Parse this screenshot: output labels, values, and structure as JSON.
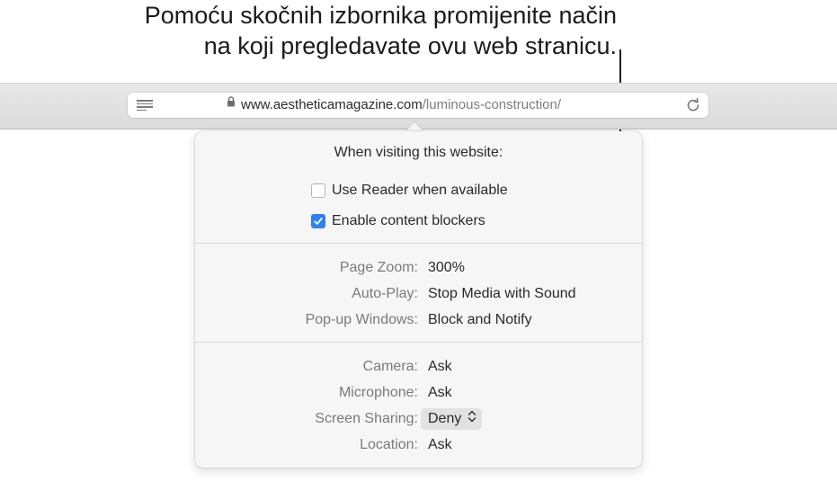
{
  "callout": {
    "line1": "Pomoću skočnih izbornika promijenite način",
    "line2": "na koji pregledavate ovu web stranicu."
  },
  "toolbar": {
    "url_domain": "www.aestheticamagazine.com",
    "url_path": "/luminous-construction/",
    "icons": [
      "reader-icon",
      "lock-icon",
      "reload-icon"
    ]
  },
  "popover": {
    "title": "When visiting this website:",
    "checkboxes": [
      {
        "label": "Use Reader when available",
        "checked": false
      },
      {
        "label": "Enable content blockers",
        "checked": true
      }
    ],
    "settings_general": [
      {
        "label": "Page Zoom:",
        "value": "300%"
      },
      {
        "label": "Auto-Play:",
        "value": "Stop Media with Sound"
      },
      {
        "label": "Pop-up Windows:",
        "value": "Block and Notify"
      }
    ],
    "settings_permissions": [
      {
        "label": "Camera:",
        "value": "Ask"
      },
      {
        "label": "Microphone:",
        "value": "Ask"
      },
      {
        "label": "Screen Sharing:",
        "value": "Deny"
      },
      {
        "label": "Location:",
        "value": "Ask"
      }
    ]
  },
  "colors": {
    "accent": "#2f7ff6",
    "popover_bg": "#f6f6f6",
    "toolbar_bg": "#e2e1e2"
  }
}
